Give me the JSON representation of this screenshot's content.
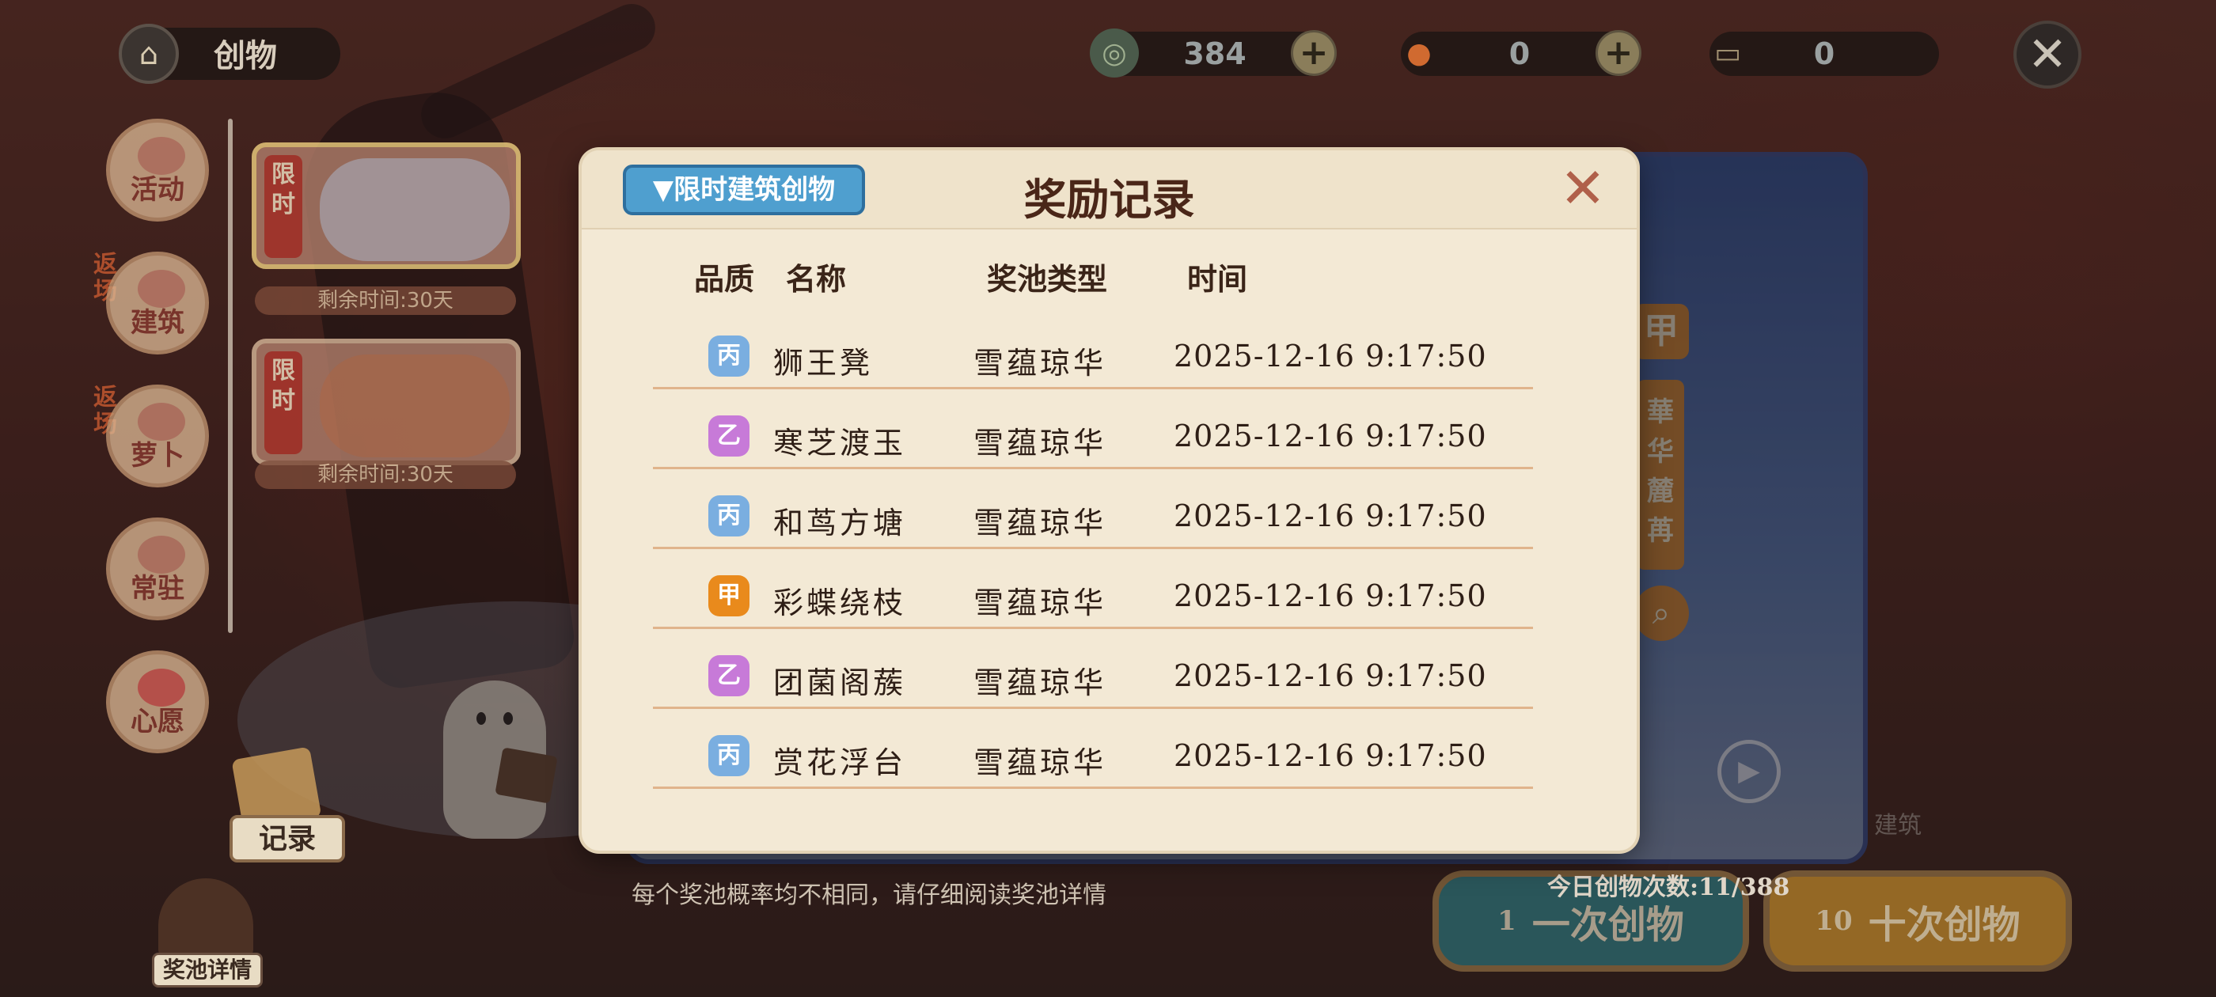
{
  "top_bar": {
    "title": "创物",
    "resources": [
      {
        "name": "coin",
        "value": "384"
      },
      {
        "name": "fruit",
        "value": "0"
      },
      {
        "name": "scroll",
        "value": "0"
      }
    ]
  },
  "sidebar": {
    "categories": [
      {
        "label": "活动",
        "return_tag": ""
      },
      {
        "label": "建筑",
        "return_tag": "返场"
      },
      {
        "label": "萝卜",
        "return_tag": "返场"
      },
      {
        "label": "常驻",
        "return_tag": ""
      },
      {
        "label": "心愿",
        "return_tag": ""
      }
    ],
    "cards": [
      {
        "tag": "限时",
        "remain": "剩余时间:30天"
      },
      {
        "tag": "限时",
        "remain": "剩余时间:30天"
      }
    ],
    "record_label": "记录",
    "pool_detail_label": "奖池详情"
  },
  "background": {
    "side_tag": "甲",
    "side_name": "華\n华\n麓\n苒",
    "building_label": "建筑",
    "today_count": "今日创物次数:11/388",
    "pool_note": "每个奖池概率均不相同，请仔细阅读奖池详情",
    "draw_once": {
      "cost": "1",
      "label": "一次创物"
    },
    "draw_ten": {
      "cost": "10",
      "label": "十次创物"
    }
  },
  "modal": {
    "title": "奖励记录",
    "filter_label": "▼限时建筑创物",
    "columns": [
      "品质",
      "名称",
      "奖池类型",
      "时间"
    ],
    "rows": [
      {
        "quality": "丙",
        "name": "狮王凳",
        "pool": "雪蕴琼华",
        "time": "2025-12-16 9:17:50"
      },
      {
        "quality": "乙",
        "name": "寒芝渡玉",
        "pool": "雪蕴琼华",
        "time": "2025-12-16 9:17:50"
      },
      {
        "quality": "丙",
        "name": "和茑方塘",
        "pool": "雪蕴琼华",
        "time": "2025-12-16 9:17:50"
      },
      {
        "quality": "甲",
        "name": "彩蝶绕枝",
        "pool": "雪蕴琼华",
        "time": "2025-12-16 9:17:50"
      },
      {
        "quality": "乙",
        "name": "团菌阁蔟",
        "pool": "雪蕴琼华",
        "time": "2025-12-16 9:17:50"
      },
      {
        "quality": "丙",
        "name": "赏花浮台",
        "pool": "雪蕴琼华",
        "time": "2025-12-16 9:17:50"
      }
    ],
    "quality_colors": {
      "甲": "#e98a1c",
      "乙": "#c77ad8",
      "丙": "#7aaee0"
    }
  }
}
